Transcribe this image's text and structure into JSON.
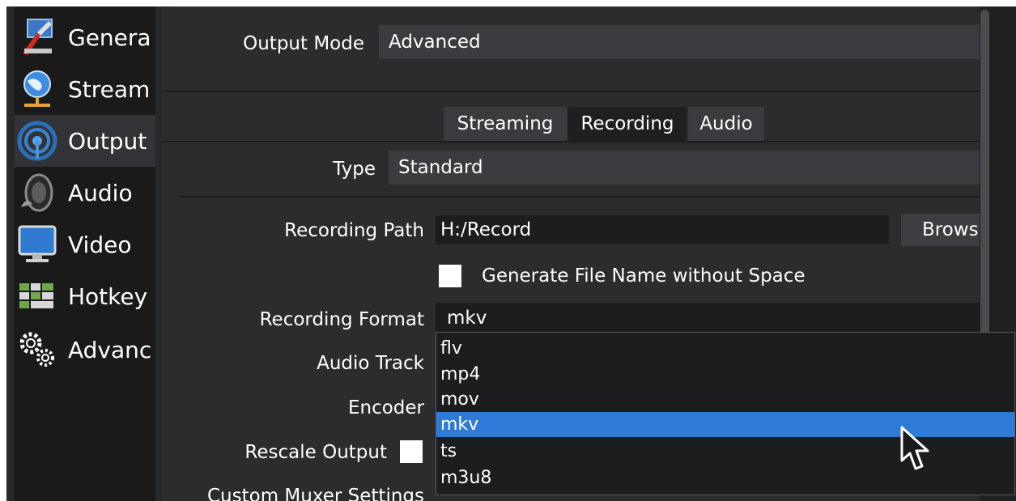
{
  "sidebar": {
    "items": [
      {
        "label": "Genera",
        "icon": "general-settings-icon"
      },
      {
        "label": "Stream",
        "icon": "globe-network-icon"
      },
      {
        "label": "Output",
        "icon": "broadcast-signal-icon"
      },
      {
        "label": "Audio",
        "icon": "speaker-icon"
      },
      {
        "label": "Video",
        "icon": "monitor-icon"
      },
      {
        "label": "Hotkey",
        "icon": "keyboard-icon"
      },
      {
        "label": "Advanc",
        "icon": "gears-icon"
      }
    ],
    "active_index": 2
  },
  "output_mode": {
    "label": "Output Mode",
    "value": "Advanced"
  },
  "tabs": [
    {
      "label": "Streaming"
    },
    {
      "label": "Recording"
    },
    {
      "label": "Audio"
    }
  ],
  "active_tab": "Recording",
  "type": {
    "label": "Type",
    "value": "Standard"
  },
  "recording_path": {
    "label": "Recording Path",
    "value": "H:/Record",
    "browse_label": "Brows"
  },
  "generate_filename": {
    "label": "Generate File Name without Space",
    "checked": false
  },
  "recording_format": {
    "label": "Recording Format",
    "value": "mkv",
    "options": [
      "flv",
      "mp4",
      "mov",
      "mkv",
      "ts",
      "m3u8"
    ],
    "highlighted": "mkv"
  },
  "audio_track": {
    "label": "Audio Track"
  },
  "encoder": {
    "label": "Encoder"
  },
  "rescale_output": {
    "label": "Rescale Output",
    "checked": false
  },
  "custom_muxer": {
    "label": "Custom Muxer Settings"
  },
  "colors": {
    "accent": "#2e7ad6",
    "background": "#2b2c2e",
    "sidebar": "#1a1a1b"
  }
}
